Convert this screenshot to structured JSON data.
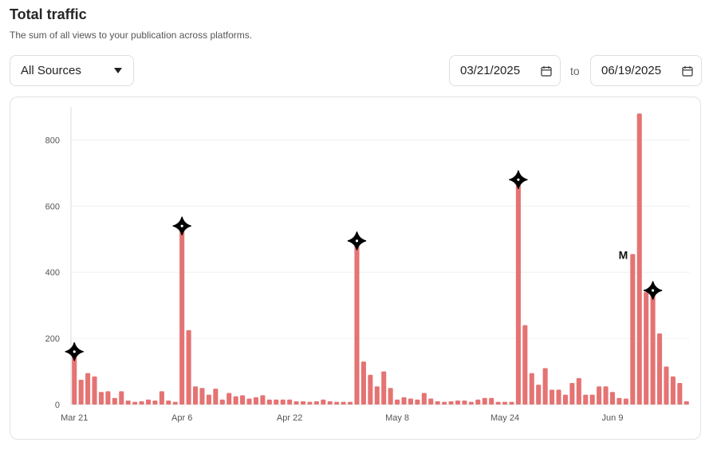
{
  "header": {
    "title": "Total traffic",
    "subtitle": "The sum of all views to your publication across platforms."
  },
  "filters": {
    "source_value": "All Sources",
    "date_start": "03/21/2025",
    "to_label": "to",
    "date_end": "06/19/2025"
  },
  "icons": {
    "dropdown": "chevron-down-icon",
    "calendar": "calendar-icon",
    "marker": "four-point-star-icon"
  },
  "colors": {
    "bar": "#e57373",
    "grid": "#f0f0f0",
    "axis": "#dcdcdc",
    "marker": "#000000"
  },
  "chart_data": {
    "type": "bar",
    "title": "",
    "xlabel": "",
    "ylabel": "",
    "ylim": [
      0,
      900
    ],
    "yticks": [
      0,
      200,
      400,
      600,
      800
    ],
    "grid": true,
    "start_date": "2025-03-21",
    "x_tick_labels": [
      {
        "index": 0,
        "label": "Mar 21"
      },
      {
        "index": 16,
        "label": "Apr 6"
      },
      {
        "index": 32,
        "label": "Apr 22"
      },
      {
        "index": 48,
        "label": "May 8"
      },
      {
        "index": 64,
        "label": "May 24"
      },
      {
        "index": 80,
        "label": "Jun 9"
      }
    ],
    "values": [
      160,
      75,
      95,
      85,
      38,
      40,
      20,
      40,
      12,
      8,
      10,
      15,
      12,
      40,
      12,
      8,
      540,
      225,
      55,
      50,
      30,
      48,
      15,
      35,
      25,
      28,
      18,
      22,
      28,
      15,
      15,
      15,
      15,
      10,
      10,
      8,
      10,
      15,
      10,
      8,
      8,
      8,
      495,
      130,
      90,
      55,
      100,
      50,
      15,
      22,
      18,
      15,
      35,
      18,
      10,
      8,
      10,
      12,
      12,
      8,
      15,
      20,
      20,
      8,
      8,
      8,
      680,
      240,
      95,
      60,
      110,
      45,
      45,
      30,
      65,
      80,
      30,
      30,
      55,
      55,
      38,
      20,
      18,
      455,
      880,
      340,
      340,
      215,
      115,
      85,
      65,
      10
    ],
    "annotations": [
      {
        "type": "marker",
        "index": 0,
        "value": 160
      },
      {
        "type": "marker",
        "index": 16,
        "value": 540
      },
      {
        "type": "marker",
        "index": 42,
        "value": 495
      },
      {
        "type": "marker",
        "index": 66,
        "value": 680
      },
      {
        "type": "text",
        "index": 83,
        "value": 455,
        "text": "M"
      },
      {
        "type": "marker",
        "index": 86,
        "value": 345
      }
    ]
  }
}
